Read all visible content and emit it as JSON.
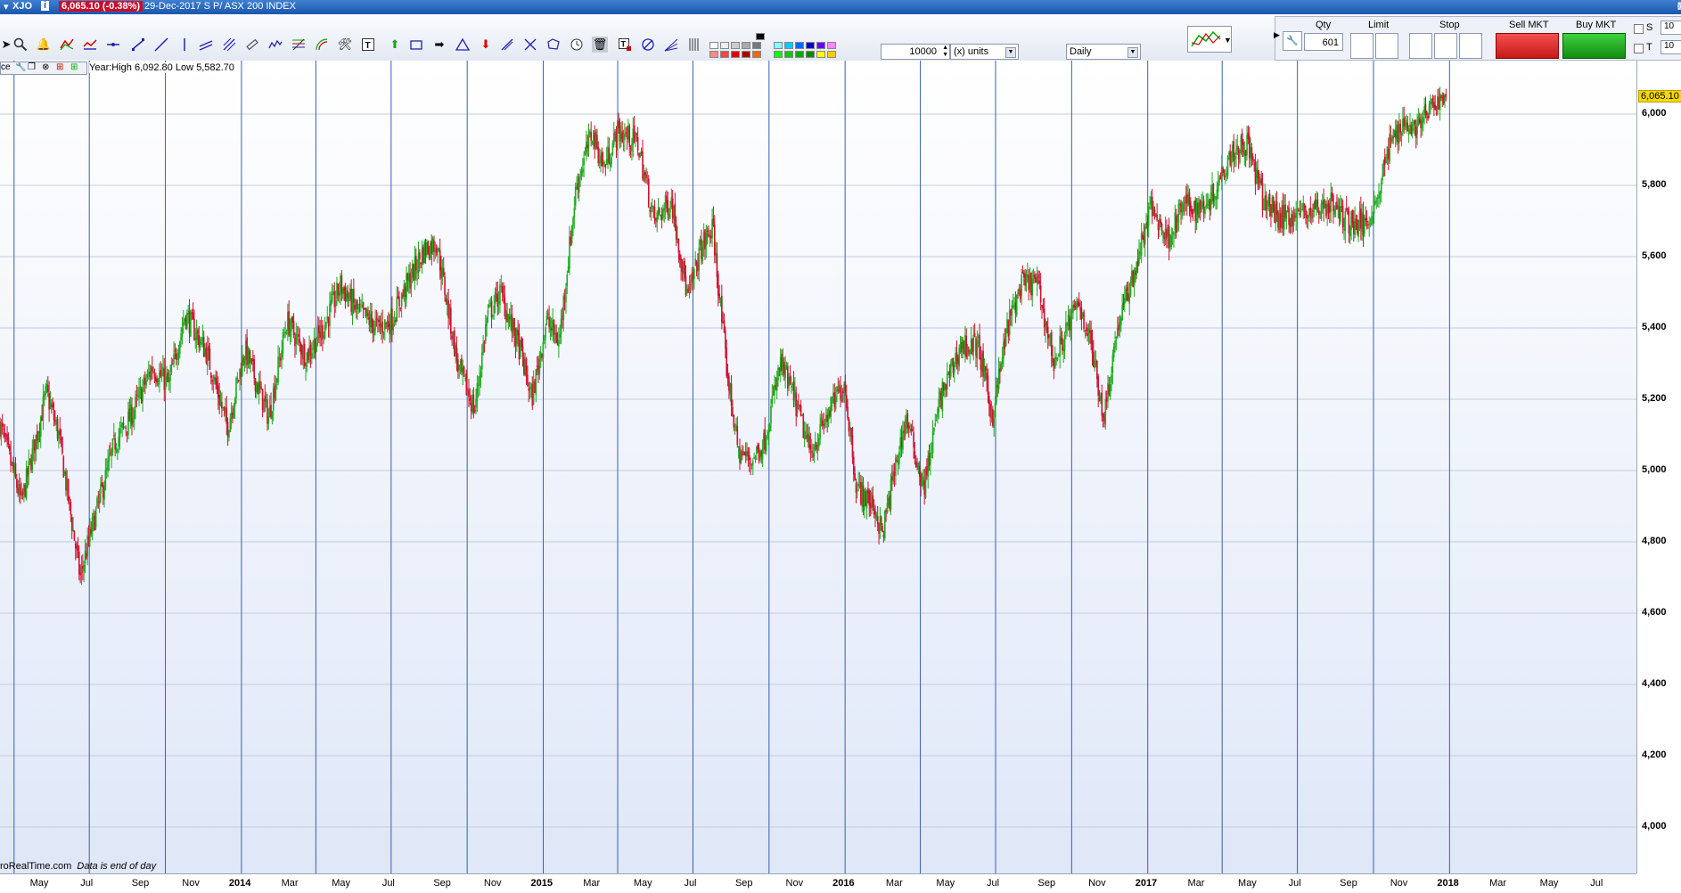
{
  "titlebar": {
    "symbol": "XJO",
    "price_change": "6,065.10 (-0.38%)",
    "date_and_name": "29-Dec-2017  S P/ ASX 200 INDEX"
  },
  "toolbar": {
    "units_value": "10000",
    "units_label": "(x) units",
    "period": "Daily"
  },
  "trade_panel": {
    "qty_label": "Qty",
    "qty_value": "601",
    "limit_label": "Limit",
    "stop_label": "Stop",
    "sell_label": "Sell MKT",
    "buy_label": "Buy MKT",
    "s_label": "S",
    "t_label": "T",
    "s_value": "10",
    "t_value": "10"
  },
  "chart_info": {
    "year_high_low": "Year:High 6,092.80 Low 5,582.70",
    "mini_label": "ce",
    "watermark": "roRealTime.com",
    "watermark_note": "Data is end of day",
    "last_price_tag": "6,065.10"
  },
  "colors": {
    "up": "#1faa1f",
    "down": "#d0102e",
    "gridline": "#3a5fb0",
    "accent": "#1b57ad"
  },
  "chart_data": {
    "type": "candlestick",
    "ylim": [
      3870,
      6150
    ],
    "yticks": [
      4000,
      4200,
      4400,
      4600,
      4800,
      5000,
      5200,
      5400,
      5600,
      5800,
      6000
    ],
    "ytick_labels": [
      "4,000",
      "4,200",
      "4,400",
      "4,600",
      "4,800",
      "5,000",
      "5,200",
      "5,400",
      "5,600",
      "5,800",
      "6,000"
    ],
    "x_range": [
      "2013-03-15",
      "2018-08-15"
    ],
    "x_ticks": [
      {
        "date": "2013-05-01",
        "label": "May",
        "year": false
      },
      {
        "date": "2013-07-01",
        "label": "Jul",
        "year": false
      },
      {
        "date": "2013-09-01",
        "label": "Sep",
        "year": false
      },
      {
        "date": "2013-11-01",
        "label": "Nov",
        "year": false
      },
      {
        "date": "2014-01-01",
        "label": "2014",
        "year": true
      },
      {
        "date": "2014-03-01",
        "label": "Mar",
        "year": false
      },
      {
        "date": "2014-05-01",
        "label": "May",
        "year": false
      },
      {
        "date": "2014-07-01",
        "label": "Jul",
        "year": false
      },
      {
        "date": "2014-09-01",
        "label": "Sep",
        "year": false
      },
      {
        "date": "2014-11-01",
        "label": "Nov",
        "year": false
      },
      {
        "date": "2015-01-01",
        "label": "2015",
        "year": true
      },
      {
        "date": "2015-03-01",
        "label": "Mar",
        "year": false
      },
      {
        "date": "2015-05-01",
        "label": "May",
        "year": false
      },
      {
        "date": "2015-07-01",
        "label": "Jul",
        "year": false
      },
      {
        "date": "2015-09-01",
        "label": "Sep",
        "year": false
      },
      {
        "date": "2015-11-01",
        "label": "Nov",
        "year": false
      },
      {
        "date": "2016-01-01",
        "label": "2016",
        "year": true
      },
      {
        "date": "2016-03-01",
        "label": "Mar",
        "year": false
      },
      {
        "date": "2016-05-01",
        "label": "May",
        "year": false
      },
      {
        "date": "2016-07-01",
        "label": "Jul",
        "year": false
      },
      {
        "date": "2016-09-01",
        "label": "Sep",
        "year": false
      },
      {
        "date": "2016-11-01",
        "label": "Nov",
        "year": false
      },
      {
        "date": "2017-01-01",
        "label": "2017",
        "year": true
      },
      {
        "date": "2017-03-01",
        "label": "Mar",
        "year": false
      },
      {
        "date": "2017-05-01",
        "label": "May",
        "year": false
      },
      {
        "date": "2017-07-01",
        "label": "Jul",
        "year": false
      },
      {
        "date": "2017-09-01",
        "label": "Sep",
        "year": false
      },
      {
        "date": "2017-11-01",
        "label": "Nov",
        "year": false
      },
      {
        "date": "2018-01-01",
        "label": "2018",
        "year": true
      },
      {
        "date": "2018-03-01",
        "label": "Mar",
        "year": false
      },
      {
        "date": "2018-05-01",
        "label": "May",
        "year": false
      },
      {
        "date": "2018-07-01",
        "label": "Jul",
        "year": false
      }
    ],
    "quarter_lines": [
      "2013-04-01",
      "2013-07-01",
      "2013-10-01",
      "2014-01-01",
      "2014-04-01",
      "2014-07-01",
      "2014-10-01",
      "2015-01-01",
      "2015-04-01",
      "2015-07-01",
      "2015-10-01",
      "2016-01-01",
      "2016-04-01",
      "2016-07-01",
      "2016-10-01",
      "2017-01-01",
      "2017-04-01",
      "2017-07-01",
      "2017-10-01",
      "2018-01-01"
    ],
    "close_path": [
      [
        "2013-03-15",
        5130
      ],
      [
        "2013-04-10",
        4910
      ],
      [
        "2013-05-10",
        5220
      ],
      [
        "2013-05-25",
        5100
      ],
      [
        "2013-06-20",
        4700
      ],
      [
        "2013-07-01",
        4810
      ],
      [
        "2013-08-01",
        5080
      ],
      [
        "2013-08-20",
        5150
      ],
      [
        "2013-09-15",
        5290
      ],
      [
        "2013-10-05",
        5240
      ],
      [
        "2013-10-25",
        5440
      ],
      [
        "2013-11-20",
        5330
      ],
      [
        "2013-12-15",
        5120
      ],
      [
        "2014-01-05",
        5340
      ],
      [
        "2014-02-03",
        5150
      ],
      [
        "2014-02-25",
        5420
      ],
      [
        "2014-03-20",
        5320
      ],
      [
        "2014-04-10",
        5400
      ],
      [
        "2014-05-01",
        5520
      ],
      [
        "2014-05-20",
        5450
      ],
      [
        "2014-06-15",
        5400
      ],
      [
        "2014-07-01",
        5420
      ],
      [
        "2014-07-20",
        5520
      ],
      [
        "2014-08-10",
        5620
      ],
      [
        "2014-08-25",
        5640
      ],
      [
        "2014-09-20",
        5290
      ],
      [
        "2014-10-10",
        5170
      ],
      [
        "2014-10-25",
        5430
      ],
      [
        "2014-11-10",
        5500
      ],
      [
        "2014-12-05",
        5330
      ],
      [
        "2014-12-18",
        5200
      ],
      [
        "2015-01-05",
        5420
      ],
      [
        "2015-01-20",
        5360
      ],
      [
        "2015-02-10",
        5800
      ],
      [
        "2015-03-01",
        5950
      ],
      [
        "2015-03-15",
        5850
      ],
      [
        "2015-04-01",
        5950
      ],
      [
        "2015-04-25",
        5920
      ],
      [
        "2015-05-15",
        5700
      ],
      [
        "2015-06-05",
        5760
      ],
      [
        "2015-06-25",
        5480
      ],
      [
        "2015-07-10",
        5620
      ],
      [
        "2015-07-25",
        5680
      ],
      [
        "2015-08-10",
        5300
      ],
      [
        "2015-08-25",
        5050
      ],
      [
        "2015-09-10",
        5030
      ],
      [
        "2015-09-25",
        5080
      ],
      [
        "2015-10-15",
        5300
      ],
      [
        "2015-11-01",
        5200
      ],
      [
        "2015-11-20",
        5050
      ],
      [
        "2015-12-10",
        5150
      ],
      [
        "2015-12-31",
        5250
      ],
      [
        "2016-01-15",
        4950
      ],
      [
        "2016-02-05",
        4900
      ],
      [
        "2016-02-15",
        4820
      ],
      [
        "2016-03-01",
        5000
      ],
      [
        "2016-03-15",
        5150
      ],
      [
        "2016-04-05",
        4950
      ],
      [
        "2016-04-25",
        5200
      ],
      [
        "2016-05-20",
        5350
      ],
      [
        "2016-06-10",
        5350
      ],
      [
        "2016-06-27",
        5150
      ],
      [
        "2016-07-15",
        5400
      ],
      [
        "2016-08-01",
        5520
      ],
      [
        "2016-08-20",
        5530
      ],
      [
        "2016-09-10",
        5300
      ],
      [
        "2016-09-25",
        5400
      ],
      [
        "2016-10-10",
        5470
      ],
      [
        "2016-10-25",
        5350
      ],
      [
        "2016-11-09",
        5150
      ],
      [
        "2016-11-25",
        5400
      ],
      [
        "2016-12-15",
        5550
      ],
      [
        "2017-01-05",
        5740
      ],
      [
        "2017-01-25",
        5650
      ],
      [
        "2017-02-15",
        5750
      ],
      [
        "2017-03-01",
        5730
      ],
      [
        "2017-03-20",
        5770
      ],
      [
        "2017-04-10",
        5890
      ],
      [
        "2017-05-01",
        5920
      ],
      [
        "2017-05-20",
        5760
      ],
      [
        "2017-06-10",
        5710
      ],
      [
        "2017-06-30",
        5720
      ],
      [
        "2017-07-20",
        5730
      ],
      [
        "2017-08-10",
        5750
      ],
      [
        "2017-08-30",
        5700
      ],
      [
        "2017-09-20",
        5690
      ],
      [
        "2017-10-05",
        5760
      ],
      [
        "2017-10-20",
        5910
      ],
      [
        "2017-11-05",
        5980
      ],
      [
        "2017-11-20",
        5960
      ],
      [
        "2017-12-05",
        6000
      ],
      [
        "2017-12-20",
        6040
      ],
      [
        "2017-12-29",
        6065
      ]
    ]
  }
}
